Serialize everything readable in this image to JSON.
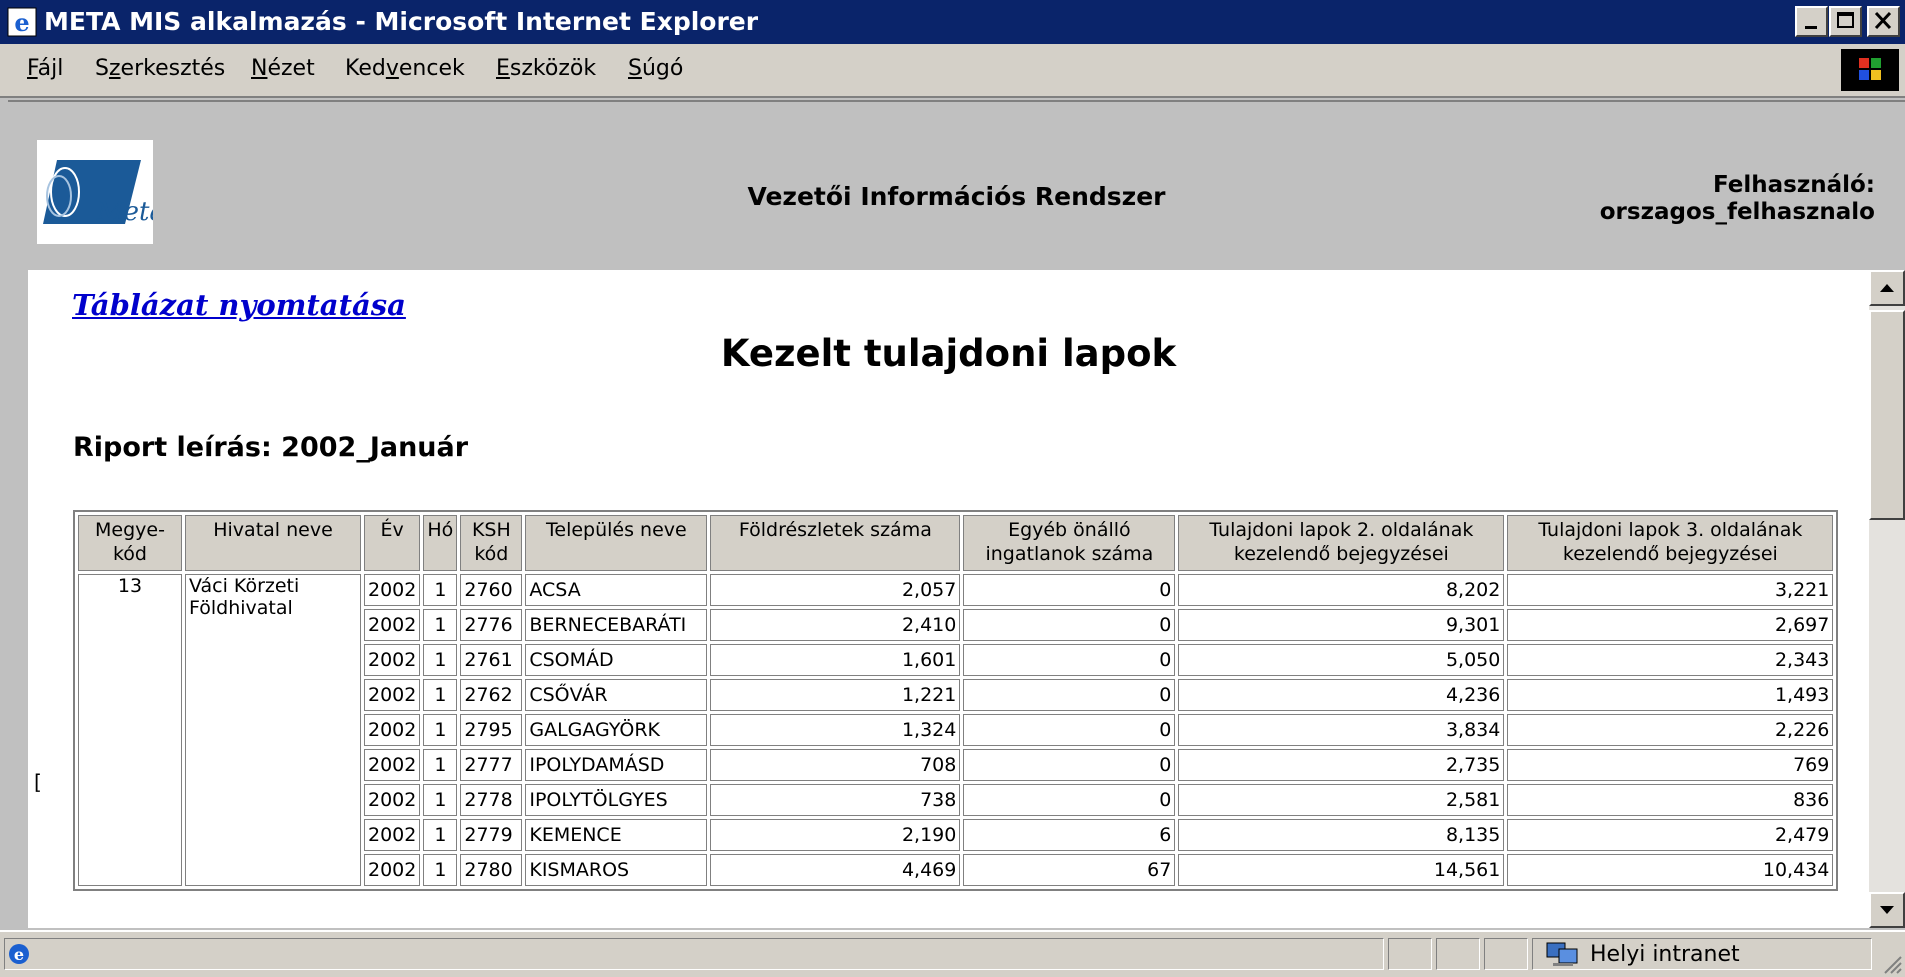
{
  "window": {
    "title": "META MIS alkalmazás - Microsoft Internet Explorer"
  },
  "menu": [
    {
      "pre": "",
      "ul": "F",
      "post": "ájl"
    },
    {
      "pre": "S",
      "ul": "z",
      "post": "erkesztés"
    },
    {
      "pre": "",
      "ul": "N",
      "post": "ézet"
    },
    {
      "pre": "Ked",
      "ul": "v",
      "post": "encek"
    },
    {
      "pre": "",
      "ul": "E",
      "post": "szközök"
    },
    {
      "pre": "",
      "ul": "S",
      "post": "úgó"
    }
  ],
  "header": {
    "logo_text": "Meta",
    "app_title": "Vezetői Információs Rendszer",
    "user_label": "Felhasználó:",
    "user_name": "orszagos_felhasznalo"
  },
  "report": {
    "print_link": "Táblázat nyomtatása",
    "title": "Kezelt tulajdoni lapok",
    "description": "Riport leírás: 2002_Január"
  },
  "table": {
    "headers": [
      "Megye-kód",
      "Hivatal neve",
      "Év",
      "Hó",
      "KSH kód",
      "Település neve",
      "Földrészletek száma",
      "Egyéb önálló ingatlanok száma",
      "Tulajdoni lapok 2. oldalának kezelendő bejegyzései",
      "Tulajdoni lapok 3. oldalának kezelendő bejegyzései"
    ],
    "group": {
      "county_code": "13",
      "office_name": "Váci Körzeti Földhivatal"
    },
    "rows": [
      {
        "year": "2002",
        "month": "1",
        "ksh": "2760",
        "settlement": "ACSA",
        "parcels": "2,057",
        "other": "0",
        "p2": "8,202",
        "p3": "3,221"
      },
      {
        "year": "2002",
        "month": "1",
        "ksh": "2776",
        "settlement": "BERNECEBARÁTI",
        "parcels": "2,410",
        "other": "0",
        "p2": "9,301",
        "p3": "2,697"
      },
      {
        "year": "2002",
        "month": "1",
        "ksh": "2761",
        "settlement": "CSOMÁD",
        "parcels": "1,601",
        "other": "0",
        "p2": "5,050",
        "p3": "2,343"
      },
      {
        "year": "2002",
        "month": "1",
        "ksh": "2762",
        "settlement": "CSŐVÁR",
        "parcels": "1,221",
        "other": "0",
        "p2": "4,236",
        "p3": "1,493"
      },
      {
        "year": "2002",
        "month": "1",
        "ksh": "2795",
        "settlement": "GALGAGYÖRK",
        "parcels": "1,324",
        "other": "0",
        "p2": "3,834",
        "p3": "2,226"
      },
      {
        "year": "2002",
        "month": "1",
        "ksh": "2777",
        "settlement": "IPOLYDAMÁSD",
        "parcels": "708",
        "other": "0",
        "p2": "2,735",
        "p3": "769"
      },
      {
        "year": "2002",
        "month": "1",
        "ksh": "2778",
        "settlement": "IPOLYTÖLGYES",
        "parcels": "738",
        "other": "0",
        "p2": "2,581",
        "p3": "836"
      },
      {
        "year": "2002",
        "month": "1",
        "ksh": "2779",
        "settlement": "KEMENCE",
        "parcels": "2,190",
        "other": "6",
        "p2": "8,135",
        "p3": "2,479"
      },
      {
        "year": "2002",
        "month": "1",
        "ksh": "2780",
        "settlement": "KISMAROS",
        "parcels": "4,469",
        "other": "67",
        "p2": "14,561",
        "p3": "10,434"
      }
    ]
  },
  "status": {
    "zone": "Helyi intranet"
  },
  "colors": {
    "titlebar": "#0a246a",
    "link": "#0000cc",
    "chrome": "#d4d0c8"
  }
}
